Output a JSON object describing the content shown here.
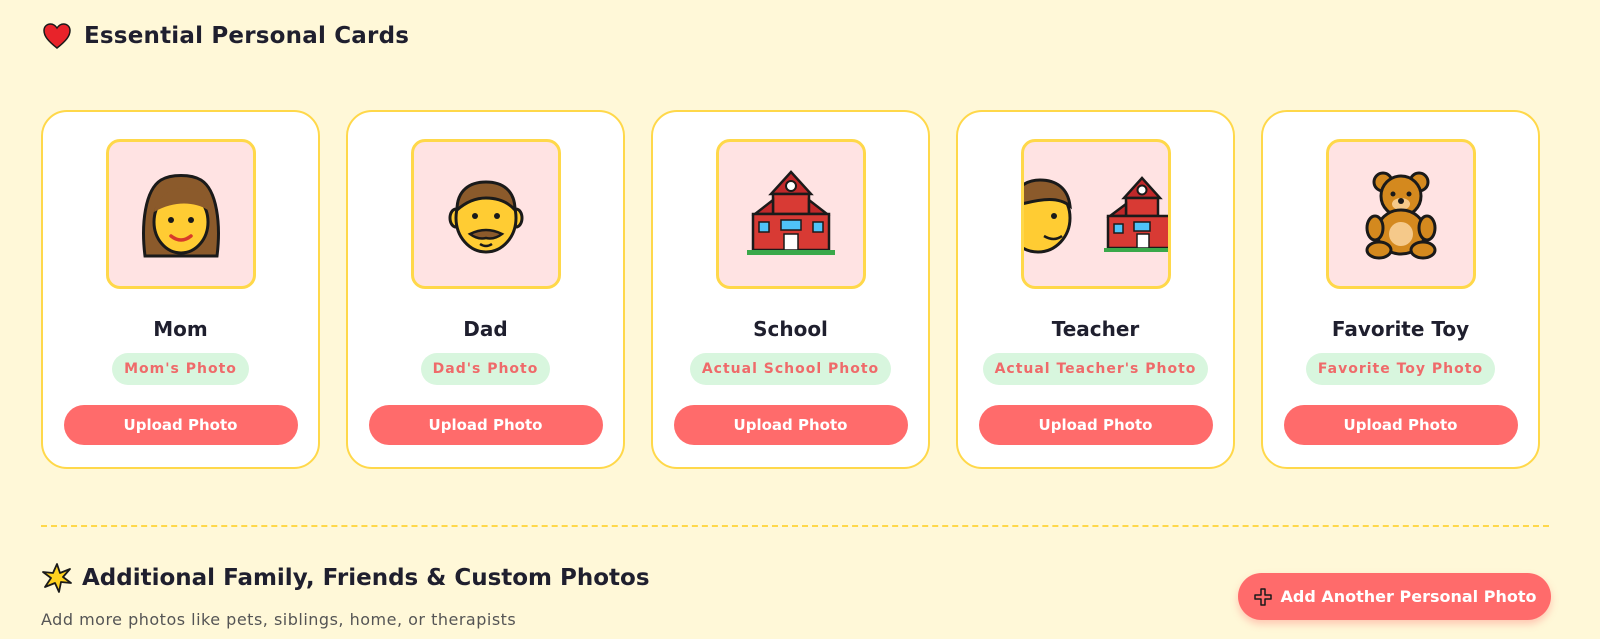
{
  "essential": {
    "title": "Essential Personal Cards",
    "icon": "heart-icon",
    "cards": [
      {
        "title": "Mom",
        "tag": "Mom's Photo",
        "button": "Upload Photo",
        "icon": "woman-face-icon"
      },
      {
        "title": "Dad",
        "tag": "Dad's Photo",
        "button": "Upload Photo",
        "icon": "man-face-icon"
      },
      {
        "title": "School",
        "tag": "Actual School Photo",
        "button": "Upload Photo",
        "icon": "school-building-icon"
      },
      {
        "title": "Teacher",
        "tag": "Actual Teacher's Photo",
        "button": "Upload Photo",
        "icon": "teacher-school-icon"
      },
      {
        "title": "Favorite Toy",
        "tag": "Favorite Toy Photo",
        "button": "Upload Photo",
        "icon": "teddy-bear-icon"
      }
    ]
  },
  "additional": {
    "title": "Additional Family, Friends & Custom Photos",
    "icon": "sparkle-icon",
    "subtitle": "Add more photos like pets, siblings, home, or therapists",
    "add_button": "Add Another Personal Photo"
  },
  "colors": {
    "background": "#fff8d8",
    "accent": "#ff6b6b",
    "border": "#ffd84a",
    "frame": "#ffe3e3",
    "tag_bg": "#d8f6de",
    "tag_text": "#ef6a6a"
  }
}
